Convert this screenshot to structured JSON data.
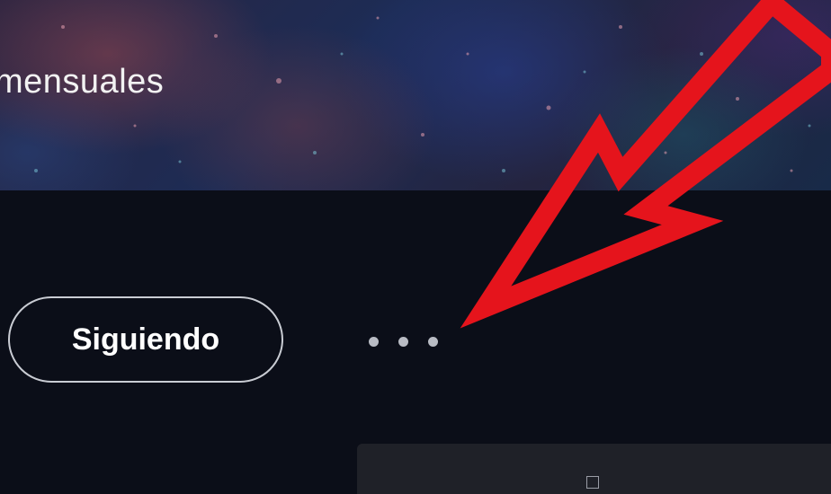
{
  "banner": {
    "text_fragment": "mensuales"
  },
  "profile_actions": {
    "follow_label": "Siguiendo",
    "more_icon": "ellipsis-icon"
  },
  "annotation": {
    "arrow_color": "#e5141c"
  },
  "colors": {
    "page_background": "#0b0e18",
    "button_border": "#c9ccd3",
    "menu_background": "#1f2128"
  }
}
